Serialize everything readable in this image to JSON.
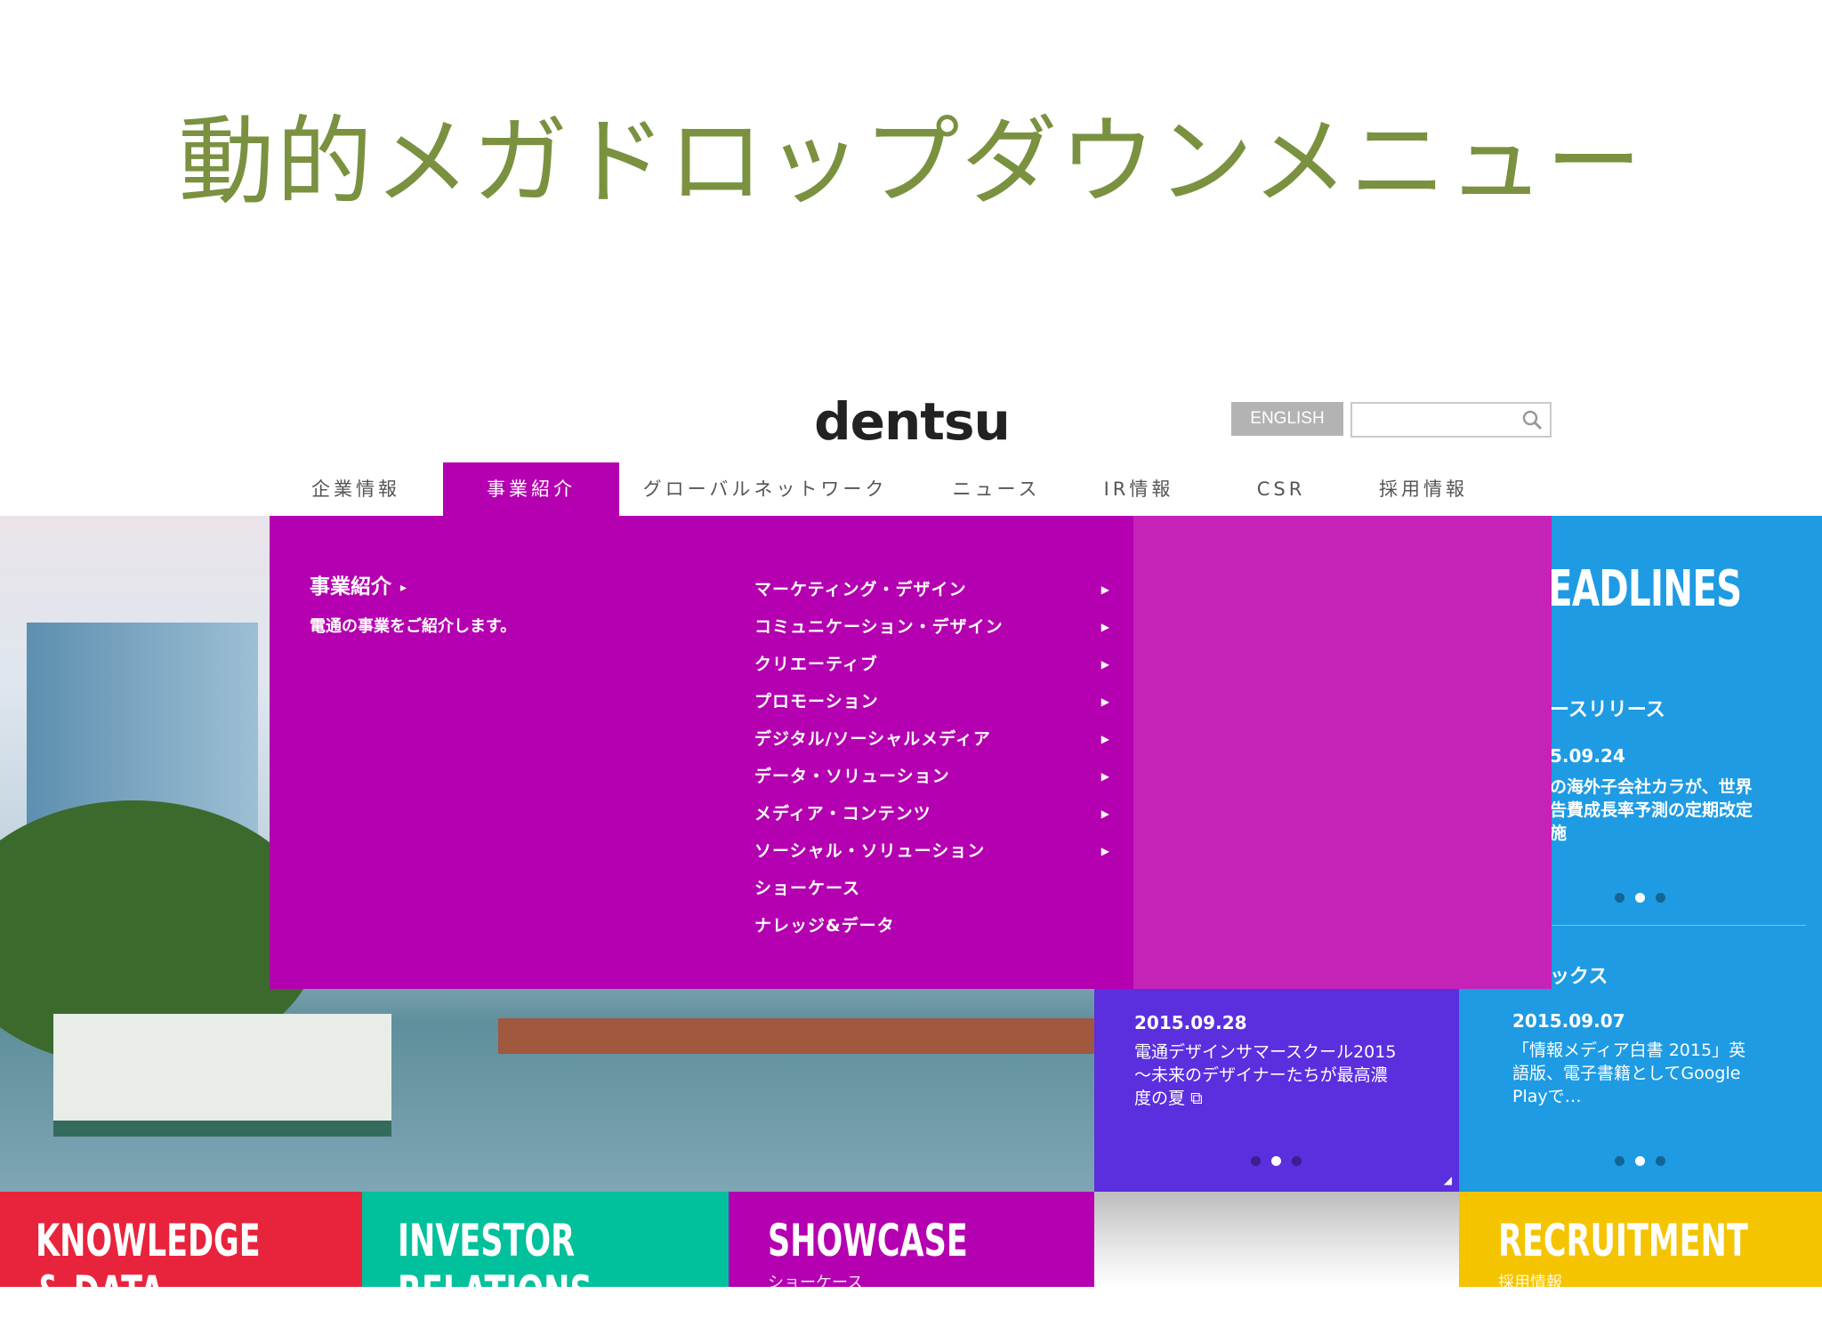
{
  "slide": {
    "title": "動的メガドロップダウンメニュー"
  },
  "header": {
    "logo": "dentsu",
    "english_label": "ENGLISH",
    "search_placeholder": ""
  },
  "nav": {
    "items": [
      {
        "label": "企業情報",
        "active": false
      },
      {
        "label": "事業紹介",
        "active": true
      },
      {
        "label": "グローバルネットワーク",
        "active": false
      },
      {
        "label": "ニュース",
        "active": false
      },
      {
        "label": "IR情報",
        "active": false
      },
      {
        "label": "CSR",
        "active": false
      },
      {
        "label": "採用情報",
        "active": false
      }
    ]
  },
  "mega_menu": {
    "title": "事業紹介",
    "description": "電通の事業をご紹介します。",
    "links": [
      {
        "label": "マーケティング・デザイン",
        "has_submenu": true
      },
      {
        "label": "コミュニケーション・デザイン",
        "has_submenu": true
      },
      {
        "label": "クリエーティブ",
        "has_submenu": true
      },
      {
        "label": "プロモーション",
        "has_submenu": true
      },
      {
        "label": "デジタル/ソーシャルメディア",
        "has_submenu": true
      },
      {
        "label": "データ・ソリューション",
        "has_submenu": true
      },
      {
        "label": "メディア・コンテンツ",
        "has_submenu": true
      },
      {
        "label": "ソーシャル・ソリューション",
        "has_submenu": true
      },
      {
        "label": "ショーケース",
        "has_submenu": false
      },
      {
        "label": "ナレッジ&データ",
        "has_submenu": false
      }
    ],
    "colors": {
      "panel": "#b400b0",
      "side": "#c522b8"
    }
  },
  "headlines": {
    "title": "EADLINES",
    "section": "ースリリース",
    "date": "5.09.24",
    "lines": [
      "の海外子会社カラが、世界",
      "告費成長率予測の定期改定",
      "施"
    ],
    "section2": "ックス"
  },
  "news_purple": {
    "date": "2015.09.28",
    "lines": [
      "電通デザインサマースクール2015",
      "〜未来のデザイナーたちが最高濃",
      "度の夏"
    ]
  },
  "news_blue": {
    "date": "2015.09.07",
    "lines": [
      "「情報メディア白書 2015」英",
      "語版、電子書籍としてGoogle",
      "Playで…"
    ]
  },
  "bottom_tiles": [
    {
      "label": "KNOWLEDGE",
      "sub": "& DATA",
      "color": "#e8243c"
    },
    {
      "label": "INVESTOR",
      "sub": "RELATIONS",
      "color": "#00c19b"
    },
    {
      "label": "SHOWCASE",
      "sub": "ショーケース",
      "color": "#b400b0"
    },
    {
      "label": "",
      "sub": "",
      "color": "#d8d8d8"
    },
    {
      "label": "RECRUITMENT",
      "sub": "採用情報",
      "color": "#f5c400"
    }
  ]
}
